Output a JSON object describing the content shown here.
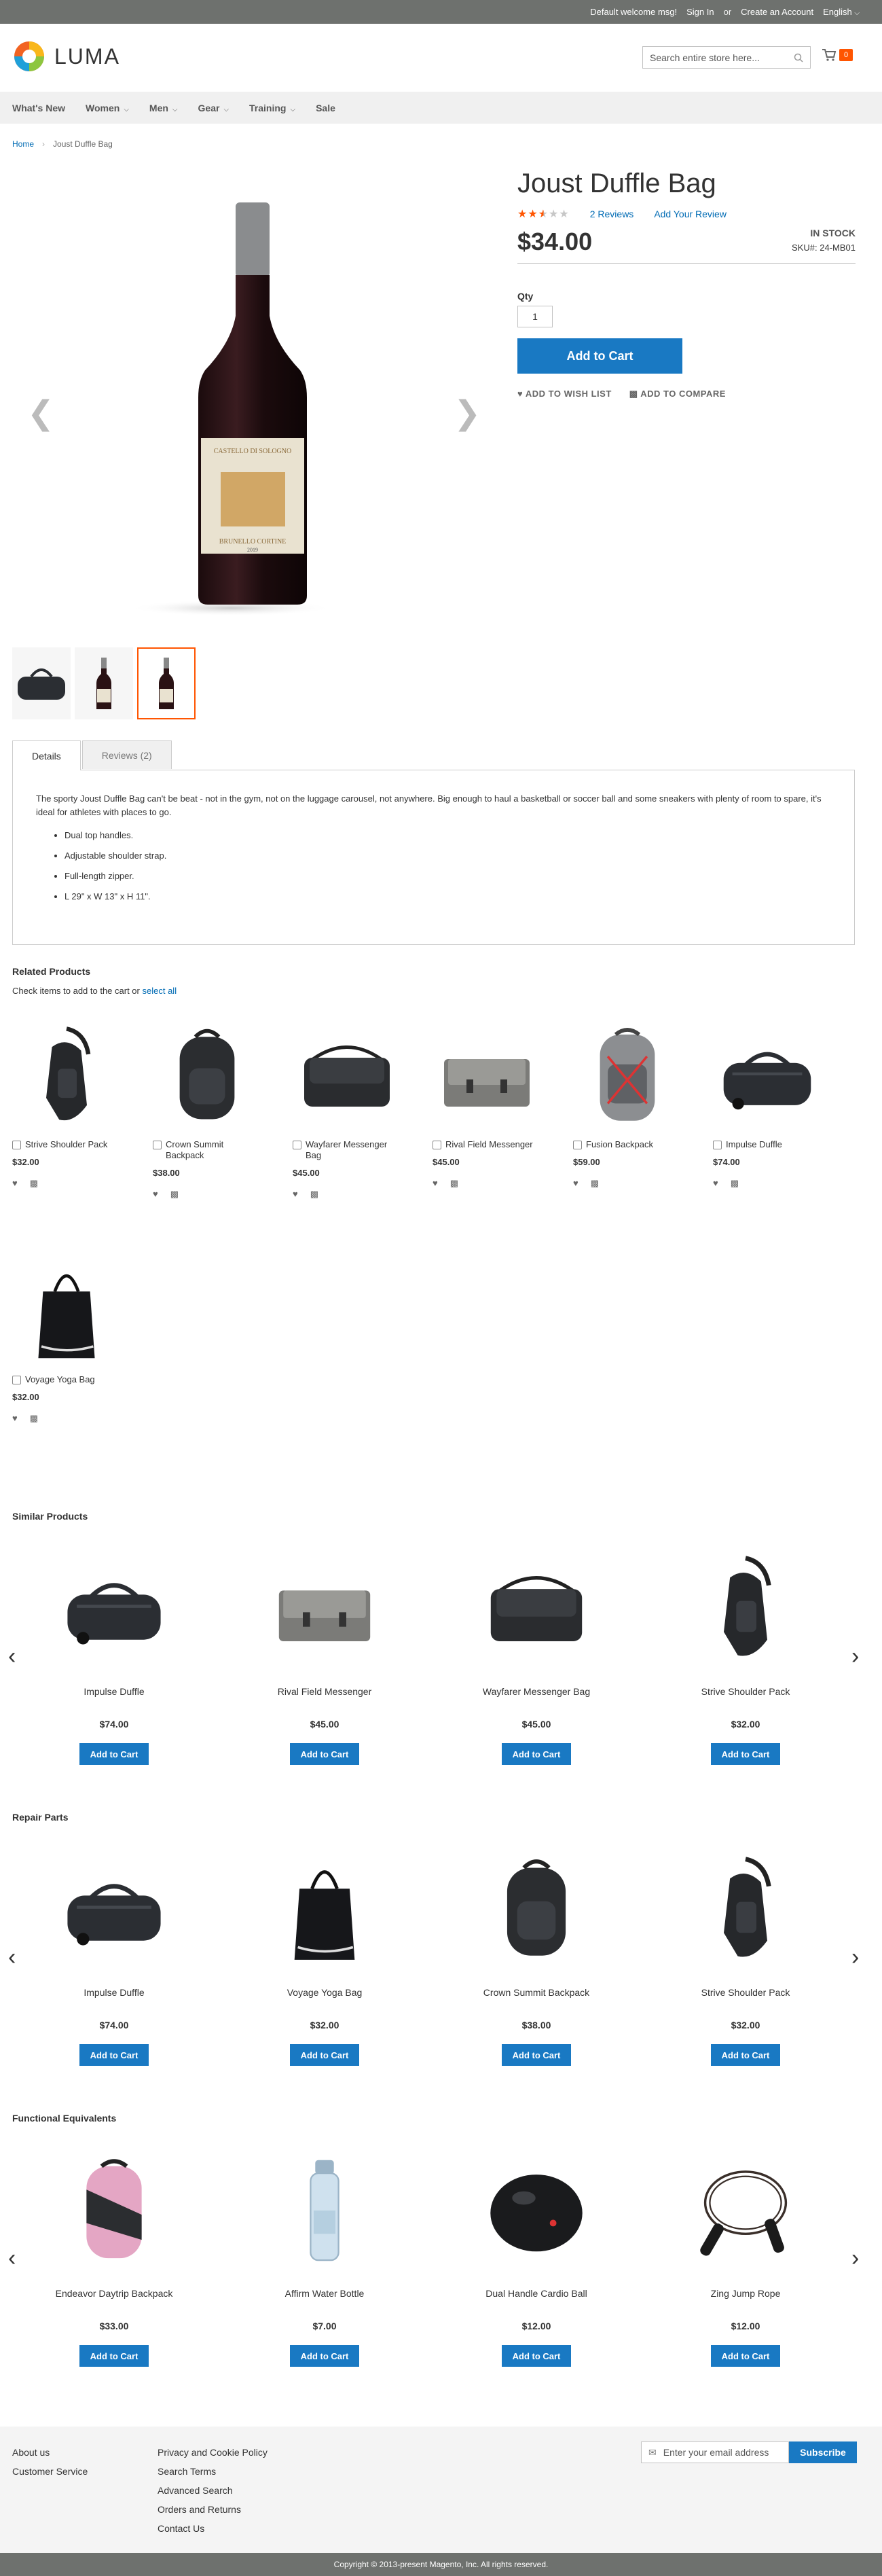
{
  "top_panel": {
    "welcome": "Default welcome msg!",
    "sign_in": "Sign In",
    "or": "or",
    "create_account": "Create an Account",
    "language": "English"
  },
  "header": {
    "logo_text": "LUMA",
    "search_placeholder": "Search entire store here...",
    "cart_count": "0"
  },
  "nav": [
    {
      "label": "What's New",
      "has_menu": false
    },
    {
      "label": "Women",
      "has_menu": true
    },
    {
      "label": "Men",
      "has_menu": true
    },
    {
      "label": "Gear",
      "has_menu": true
    },
    {
      "label": "Training",
      "has_menu": true
    },
    {
      "label": "Sale",
      "has_menu": false
    }
  ],
  "breadcrumb": {
    "home": "Home",
    "current": "Joust Duffle Bag"
  },
  "product": {
    "title": "Joust Duffle Bag",
    "rating": 2.5,
    "reviews_link": "2 Reviews",
    "add_review": "Add Your Review",
    "price": "$34.00",
    "stock": "IN STOCK",
    "sku_label": "SKU#:",
    "sku": "24-MB01",
    "qty_label": "Qty",
    "qty": "1",
    "add_to_cart": "Add to Cart",
    "wishlist": "ADD TO WISH LIST",
    "compare": "ADD TO COMPARE",
    "bottle_label_top": "CASTELLO DI SOLOGNO",
    "bottle_label_bottom": "BRUNELLO CORTINE",
    "bottle_year": "2019"
  },
  "tabs": {
    "details": "Details",
    "reviews": "Reviews (2)",
    "description": "The sporty Joust Duffle Bag can't be beat - not in the gym, not on the luggage carousel, not anywhere. Big enough to haul a basketball or soccer ball and some sneakers with plenty of room to spare, it's ideal for athletes with places to go.",
    "features": [
      "Dual top handles.",
      "Adjustable shoulder strap.",
      "Full-length zipper.",
      "L 29\" x W 13\" x H 11\"."
    ]
  },
  "related": {
    "title": "Related Products",
    "subtitle": "Check items to add to the cart or",
    "select_all": "select all",
    "items": [
      {
        "name": "Strive Shoulder Pack",
        "price": "$32.00",
        "icon": "sling-bag"
      },
      {
        "name": "Crown Summit Backpack",
        "price": "$38.00",
        "icon": "backpack"
      },
      {
        "name": "Wayfarer Messenger Bag",
        "price": "$45.00",
        "icon": "messenger"
      },
      {
        "name": "Rival Field Messenger",
        "price": "$45.00",
        "icon": "messenger-grey"
      },
      {
        "name": "Fusion Backpack",
        "price": "$59.00",
        "icon": "backpack-grey"
      },
      {
        "name": "Impulse Duffle",
        "price": "$74.00",
        "icon": "duffle"
      },
      {
        "name": "Voyage Yoga Bag",
        "price": "$32.00",
        "icon": "tote"
      }
    ]
  },
  "similar": {
    "title": "Similar Products",
    "items": [
      {
        "name": "Impulse Duffle",
        "price": "$74.00",
        "icon": "duffle"
      },
      {
        "name": "Rival Field Messenger",
        "price": "$45.00",
        "icon": "messenger-grey"
      },
      {
        "name": "Wayfarer Messenger Bag",
        "price": "$45.00",
        "icon": "messenger"
      },
      {
        "name": "Strive Shoulder Pack",
        "price": "$32.00",
        "icon": "sling-bag"
      }
    ]
  },
  "repair": {
    "title": "Repair Parts",
    "items": [
      {
        "name": "Impulse Duffle",
        "price": "$74.00",
        "icon": "duffle"
      },
      {
        "name": "Voyage Yoga Bag",
        "price": "$32.00",
        "icon": "tote"
      },
      {
        "name": "Crown Summit Backpack",
        "price": "$38.00",
        "icon": "backpack"
      },
      {
        "name": "Strive Shoulder Pack",
        "price": "$32.00",
        "icon": "sling-bag"
      }
    ]
  },
  "equivalents": {
    "title": "Functional Equivalents",
    "items": [
      {
        "name": "Endeavor Daytrip Backpack",
        "price": "$33.00",
        "icon": "backpack-pink"
      },
      {
        "name": "Affirm Water Bottle",
        "price": "$7.00",
        "icon": "bottle"
      },
      {
        "name": "Dual Handle Cardio Ball",
        "price": "$12.00",
        "icon": "ball"
      },
      {
        "name": "Zing Jump Rope",
        "price": "$12.00",
        "icon": "rope"
      }
    ]
  },
  "carousel_button": "Add to Cart",
  "footer": {
    "col1": [
      "About us",
      "Customer Service"
    ],
    "col2": [
      "Privacy and Cookie Policy",
      "Search Terms",
      "Advanced Search",
      "Orders and Returns",
      "Contact Us"
    ],
    "newsletter_placeholder": "Enter your email address",
    "subscribe": "Subscribe",
    "copyright": "Copyright © 2013-present Magento, Inc. All rights reserved."
  },
  "colors": {
    "accent": "#1979c3",
    "orange": "#ff5501",
    "link": "#006bb4",
    "dark_bar": "#6e716e"
  }
}
